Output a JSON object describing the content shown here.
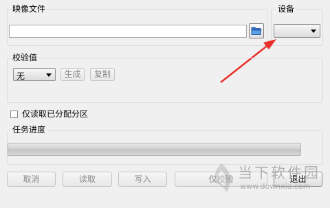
{
  "image_file": {
    "title": "映像文件",
    "path_value": ""
  },
  "device": {
    "title": "设备",
    "selected": ""
  },
  "checksum": {
    "title": "校验值",
    "algorithm": "无",
    "generate_label": "生成",
    "copy_label": "复制"
  },
  "readonly_partitions": {
    "label": "仅读取已分配分区",
    "checked": false
  },
  "progress": {
    "title": "任务进度",
    "value": 0
  },
  "buttons": {
    "cancel": "取消",
    "read": "读取",
    "write": "写入",
    "verify": "仅校验",
    "exit": "退出"
  },
  "watermark": {
    "brand": "当下软件园",
    "url": "www.downxia.com"
  },
  "annotation": {
    "arrow_color": "#e8302a"
  }
}
